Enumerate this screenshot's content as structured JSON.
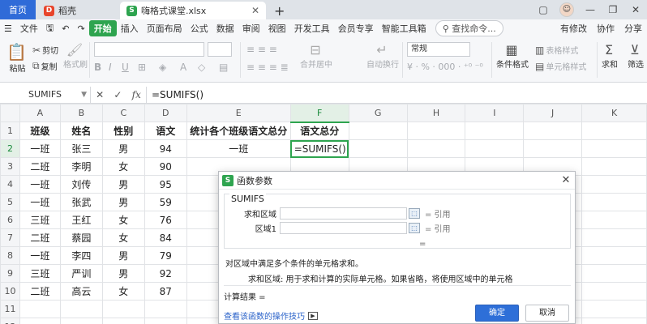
{
  "tabs": {
    "home": "首页",
    "daoke": "稻壳",
    "file": "嗨格式课堂.xlsx",
    "add": "+"
  },
  "window": {
    "minimize": "—",
    "restore": "❐",
    "close": "✕",
    "avatar": "☺"
  },
  "menu": {
    "items": [
      "文件",
      "开始",
      "插入",
      "页面布局",
      "公式",
      "数据",
      "审阅",
      "视图",
      "开发工具",
      "会员专享",
      "智能工具箱"
    ],
    "active": "开始",
    "search": "查找命令...",
    "right": [
      "有修改",
      "协作",
      "分享"
    ]
  },
  "toolbar": {
    "paste": "粘贴",
    "cut": "剪切",
    "copy": "复制",
    "format_painter": "格式刷",
    "merge": "合并居中",
    "wrap": "自动换行",
    "number_format": "常规",
    "cond_format": "条件格式",
    "cell_style": "单元格样式",
    "sum": "求和",
    "filter": "筛选"
  },
  "formula_bar": {
    "name_box": "SUMIFS",
    "cancel": "✕",
    "confirm": "✓",
    "fx": "fx",
    "formula": "=SUMIFS()"
  },
  "sheet": {
    "columns": [
      "A",
      "B",
      "C",
      "D",
      "E",
      "F",
      "G",
      "H",
      "I",
      "J",
      "K"
    ],
    "row_numbers": [
      "1",
      "2",
      "3",
      "4",
      "5",
      "6",
      "7",
      "8",
      "9",
      "10",
      "11",
      "12"
    ],
    "active_column": "F",
    "active_row": "2",
    "rows": [
      [
        "班级",
        "姓名",
        "性别",
        "语文",
        "统计各个班级语文总分",
        "语文总分",
        "",
        "",
        "",
        "",
        ""
      ],
      [
        "一班",
        "张三",
        "男",
        "94",
        "一班",
        "=SUMIFS()",
        "",
        "",
        "",
        "",
        ""
      ],
      [
        "二班",
        "李明",
        "女",
        "90",
        "",
        "",
        "",
        "",
        "",
        "",
        ""
      ],
      [
        "一班",
        "刘传",
        "男",
        "95",
        "",
        "",
        "",
        "",
        "",
        "",
        ""
      ],
      [
        "一班",
        "张武",
        "男",
        "59",
        "",
        "",
        "",
        "",
        "",
        "",
        ""
      ],
      [
        "三班",
        "王红",
        "女",
        "76",
        "",
        "",
        "",
        "",
        "",
        "",
        ""
      ],
      [
        "二班",
        "蔡园",
        "女",
        "84",
        "",
        "",
        "",
        "",
        "",
        "",
        ""
      ],
      [
        "一班",
        "李四",
        "男",
        "79",
        "",
        "",
        "",
        "",
        "",
        "",
        ""
      ],
      [
        "三班",
        "严训",
        "男",
        "92",
        "",
        "",
        "",
        "",
        "",
        "",
        ""
      ],
      [
        "二班",
        "高云",
        "女",
        "87",
        "",
        "",
        "",
        "",
        "",
        "",
        ""
      ],
      [
        "",
        "",
        "",
        "",
        "",
        "",
        "",
        "",
        "",
        "",
        ""
      ],
      [
        "",
        "",
        "",
        "",
        "",
        "",
        "",
        "",
        "",
        "",
        ""
      ]
    ]
  },
  "dialog": {
    "title": "函数参数",
    "function_name": "SUMIFS",
    "args": [
      {
        "label": "求和区域",
        "eq": "= 引用"
      },
      {
        "label": "区域1",
        "eq": "= 引用"
      }
    ],
    "result_eq": "=",
    "description": "对区域中满足多个条件的单元格求和。",
    "arg_description": "求和区域:  用于求和计算的实际单元格。如果省略，将使用区域中的单元格",
    "result_label": "计算结果 =",
    "help_link": "查看该函数的操作技巧",
    "ok": "确定",
    "cancel": "取消"
  }
}
